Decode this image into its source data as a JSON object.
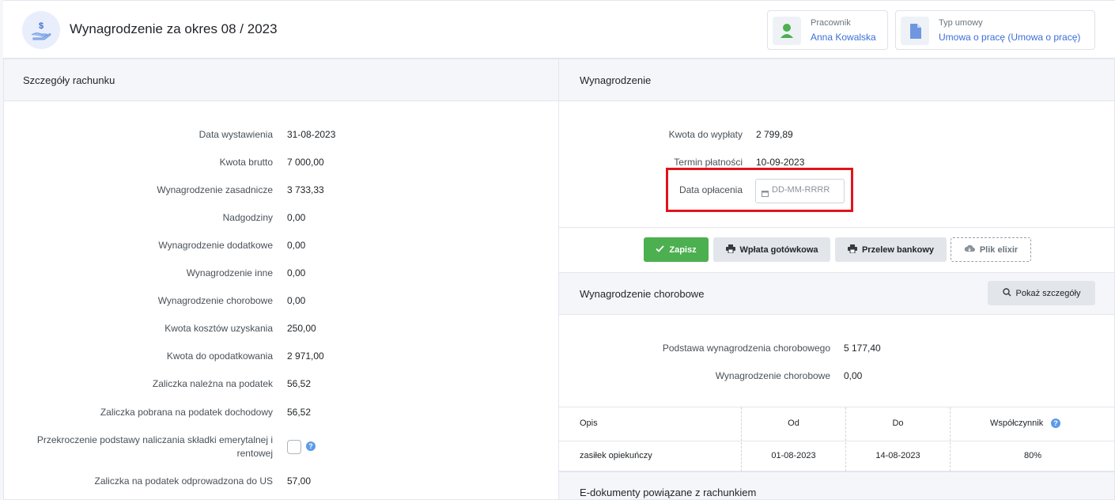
{
  "header": {
    "title": "Wynagrodzenie za okres 08 / 2023",
    "employee": {
      "label": "Pracownik",
      "value": "Anna Kowalska"
    },
    "contract": {
      "label": "Typ umowy",
      "value": "Umowa o pracę (Umowa o pracę)"
    }
  },
  "left_panel": {
    "title": "Szczegóły rachunku",
    "rows": [
      {
        "label": "Data wystawienia",
        "value": "31-08-2023"
      },
      {
        "label": "Kwota brutto",
        "value": "7 000,00"
      },
      {
        "label": "Wynagrodzenie zasadnicze",
        "value": "3 733,33"
      },
      {
        "label": "Nadgodziny",
        "value": "0,00"
      },
      {
        "label": "Wynagrodzenie dodatkowe",
        "value": "0,00"
      },
      {
        "label": "Wynagrodzenie inne",
        "value": "0,00"
      },
      {
        "label": "Wynagrodzenie chorobowe",
        "value": "0,00"
      },
      {
        "label": "Kwota kosztów uzyskania",
        "value": "250,00"
      },
      {
        "label": "Kwota do opodatkowania",
        "value": "2 971,00"
      },
      {
        "label": "Zaliczka należna na podatek",
        "value": "56,52"
      },
      {
        "label": "Zaliczka pobrana na podatek dochodowy",
        "value": "56,52"
      }
    ],
    "exceed_label_1": "Przekroczenie podstawy naliczania składki emerytalnej i",
    "exceed_label_2": "rentowej",
    "last_row": {
      "label": "Zaliczka na podatek odprowadzona do US",
      "value": "57,00"
    }
  },
  "right_panel": {
    "title": "Wynagrodzenie",
    "payout_label": "Kwota do wypłaty",
    "payout_value": "2 799,89",
    "due_label": "Termin płatności",
    "due_value": "10-09-2023",
    "paid_label": "Data opłacenia",
    "paid_placeholder": "DD-MM-RRRR",
    "buttons": {
      "save": "Zapisz",
      "cash": "Wpłata gotówkowa",
      "transfer": "Przelew bankowy",
      "elixir": "Plik elixir"
    }
  },
  "sick_panel": {
    "title": "Wynagrodzenie chorobowe",
    "details_button": "Pokaż szczegóły",
    "base_label": "Podstawa wynagrodzenia chorobowego",
    "base_value": "5 177,40",
    "sick_label": "Wynagrodzenie chorobowe",
    "sick_value": "0,00",
    "table": {
      "headers": [
        "Opis",
        "Od",
        "Do",
        "Współczynnik"
      ],
      "rows": [
        [
          "zasiłek opiekuńczy",
          "01-08-2023",
          "14-08-2023",
          "80%"
        ]
      ]
    }
  },
  "edocs_panel": {
    "title": "E-dokumenty powiązane z rachunkiem"
  },
  "colors": {
    "accent": "#3b6fd6",
    "success": "#4caf50",
    "highlight": "#e0141b"
  }
}
